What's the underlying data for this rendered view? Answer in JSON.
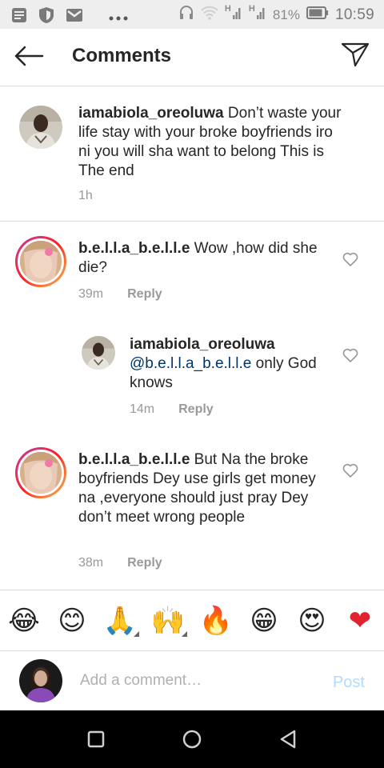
{
  "status_bar": {
    "icons": [
      "message-icon",
      "shield-icon",
      "gmail-icon",
      "more-dots-icon",
      "headset-icon",
      "wifi-icon",
      "signal-h-icon",
      "signal-h-icon-2",
      "battery-icon"
    ],
    "network_1": "H",
    "network_2": "H",
    "battery": "81%",
    "time": "10:59"
  },
  "header": {
    "title": "Comments",
    "back_icon": "arrow-left-icon",
    "send_icon": "send-paper-plane-icon"
  },
  "comments": [
    {
      "username": "iamabiola_oreoluwa",
      "text": " Don’t waste your life stay with your broke boyfriends iro ni you will sha want to belong This is The end",
      "time": "1h"
    },
    {
      "username": "b.e.l.l.a_b.e.l.l.e",
      "text": " Wow ,how did she die?",
      "time": "39m",
      "reply_label": "Reply"
    },
    {
      "username": "iamabiola_oreoluwa",
      "mention": "@b.e.l.l.a_b.e.l.l.e",
      "text": " only God knows",
      "time": "14m",
      "reply_label": "Reply"
    },
    {
      "username": "b.e.l.l.a_b.e.l.l.e",
      "text": " But Na the broke boyfriends Dey use girls get money na ,everyone should just pray Dey don’t meet  wrong people",
      "time": "38m",
      "reply_label": "Reply"
    }
  ],
  "emoji_bar": [
    {
      "name": "tears-of-joy-emoji",
      "glyph": "😂"
    },
    {
      "name": "smiling-emoji",
      "glyph": "😊"
    },
    {
      "name": "folded-hands-emoji",
      "glyph": "🙏"
    },
    {
      "name": "raising-hands-emoji",
      "glyph": "🙌"
    },
    {
      "name": "fire-emoji",
      "glyph": "🔥"
    },
    {
      "name": "grinning-emoji",
      "glyph": "😁"
    },
    {
      "name": "heart-eyes-emoji",
      "glyph": "😍"
    },
    {
      "name": "red-heart-emoji",
      "glyph": "❤"
    }
  ],
  "compose": {
    "placeholder": "Add a comment…",
    "post_label": "Post"
  },
  "nav_bar": {
    "icons": [
      "recents-square-icon",
      "home-circle-icon",
      "back-triangle-icon"
    ]
  },
  "colors": {
    "accent_post_disabled": "#b3dbff",
    "mention": "#003569",
    "divider": "#dbdbdb",
    "meta_grey": "#999999",
    "status_bar_bg": "#eeeeee"
  }
}
